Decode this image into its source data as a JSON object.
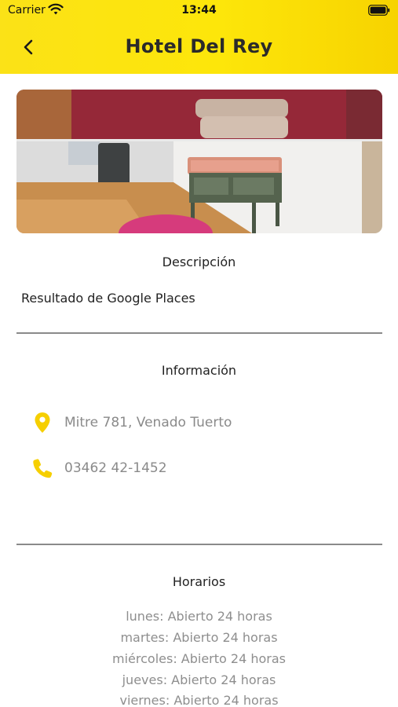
{
  "status_bar": {
    "carrier": "Carrier",
    "time": "13:44"
  },
  "header": {
    "title": "Hotel Del Rey"
  },
  "description": {
    "heading": "Descripción",
    "text": "Resultado de Google Places"
  },
  "information": {
    "heading": "Información",
    "address": "Mitre 781, Venado Tuerto",
    "phone": "03462 42-1452"
  },
  "hours": {
    "heading": "Horarios",
    "lines": [
      "lunes: Abierto 24 horas",
      "martes: Abierto 24 horas",
      "miércoles: Abierto 24 horas",
      "jueves: Abierto 24 horas",
      "viernes: Abierto 24 horas"
    ]
  },
  "colors": {
    "accent": "#f7d200",
    "header_bg": "#fde60a",
    "muted_text": "#8a8a8a"
  }
}
